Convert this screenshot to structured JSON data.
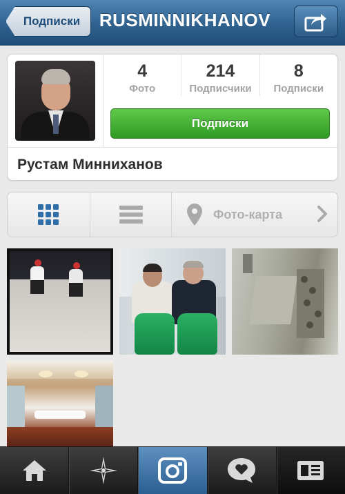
{
  "navbar": {
    "back_label": "Подписки",
    "title": "RUSMINNIKHANOV",
    "share_icon": "share-icon"
  },
  "profile": {
    "name": "Рустам Минниханов",
    "stats": [
      {
        "value": "4",
        "label": "Фото"
      },
      {
        "value": "214",
        "label": "Подписчики"
      },
      {
        "value": "8",
        "label": "Подписки"
      }
    ],
    "follow_label": "Подписки"
  },
  "view_tabs": {
    "grid_icon": "grid-icon",
    "list_icon": "list-icon",
    "map_label": "Фото-карта"
  },
  "photos": [
    {
      "subject": "hockey-players"
    },
    {
      "subject": "two-men-green-chairs"
    },
    {
      "subject": "aerial-city-square"
    },
    {
      "subject": "conference-hall-interior"
    }
  ],
  "tabbar": {
    "items": [
      "home-icon",
      "explore-icon",
      "camera-icon",
      "activity-icon",
      "news-icon"
    ],
    "active_index": 2
  },
  "colors": {
    "nav_blue": "#2f628f",
    "follow_green": "#3fae2b",
    "grid_icon_blue": "#2f6ea8"
  }
}
